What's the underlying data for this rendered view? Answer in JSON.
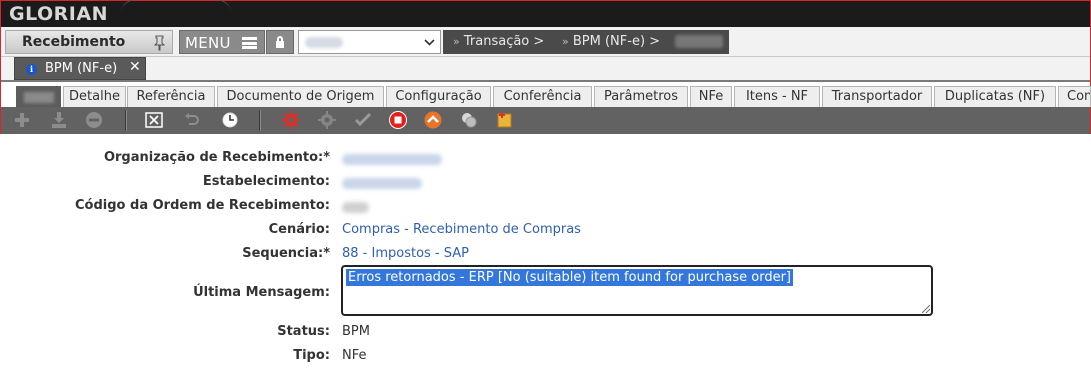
{
  "app": {
    "logo_text": "GLORIAN",
    "module_label": "Recebimento",
    "menu_label": "MENU"
  },
  "breadcrumbs": [
    "Transação >",
    "BPM (NF-e) >"
  ],
  "document_tab": {
    "label": "BPM (NF-e)",
    "close": "✕"
  },
  "tabs": [
    "",
    "Detalhe",
    "Referência",
    "Documento de Origem",
    "Configuração",
    "Conferência",
    "Parâmetros",
    "NFe",
    "Itens - NF",
    "Transportador",
    "Duplicatas (NF)",
    "Con"
  ],
  "toolbar": {
    "icons": [
      "add-icon",
      "download-icon",
      "remove-icon",
      "cancel-icon",
      "undo-icon",
      "history-icon",
      "gear-icon",
      "gear-disabled-icon",
      "check-icon",
      "stop-icon",
      "up-icon",
      "coins-icon",
      "export-icon"
    ]
  },
  "form": {
    "org_label": "Organização de Recebimento:*",
    "estab_label": "Estabelecimento:",
    "ordem_label": "Código da Ordem de Recebimento:",
    "cenario_label": "Cenário:",
    "cenario_value": "Compras - Recebimento de Compras",
    "sequencia_label": "Sequencia:*",
    "sequencia_value": "88 - Impostos - SAP",
    "mensagem_label": "Última Mensagem:",
    "mensagem_value": "Erros retornados - ERP [No (suitable) item found for purchase order]",
    "status_label": "Status:",
    "status_value": "BPM",
    "tipo_label": "Tipo:",
    "tipo_value": "NFe"
  },
  "colors": {
    "accent_border": "#d9262b",
    "link": "#2f5fb0",
    "selection": "#3377dd",
    "toolbar": "#626262"
  }
}
